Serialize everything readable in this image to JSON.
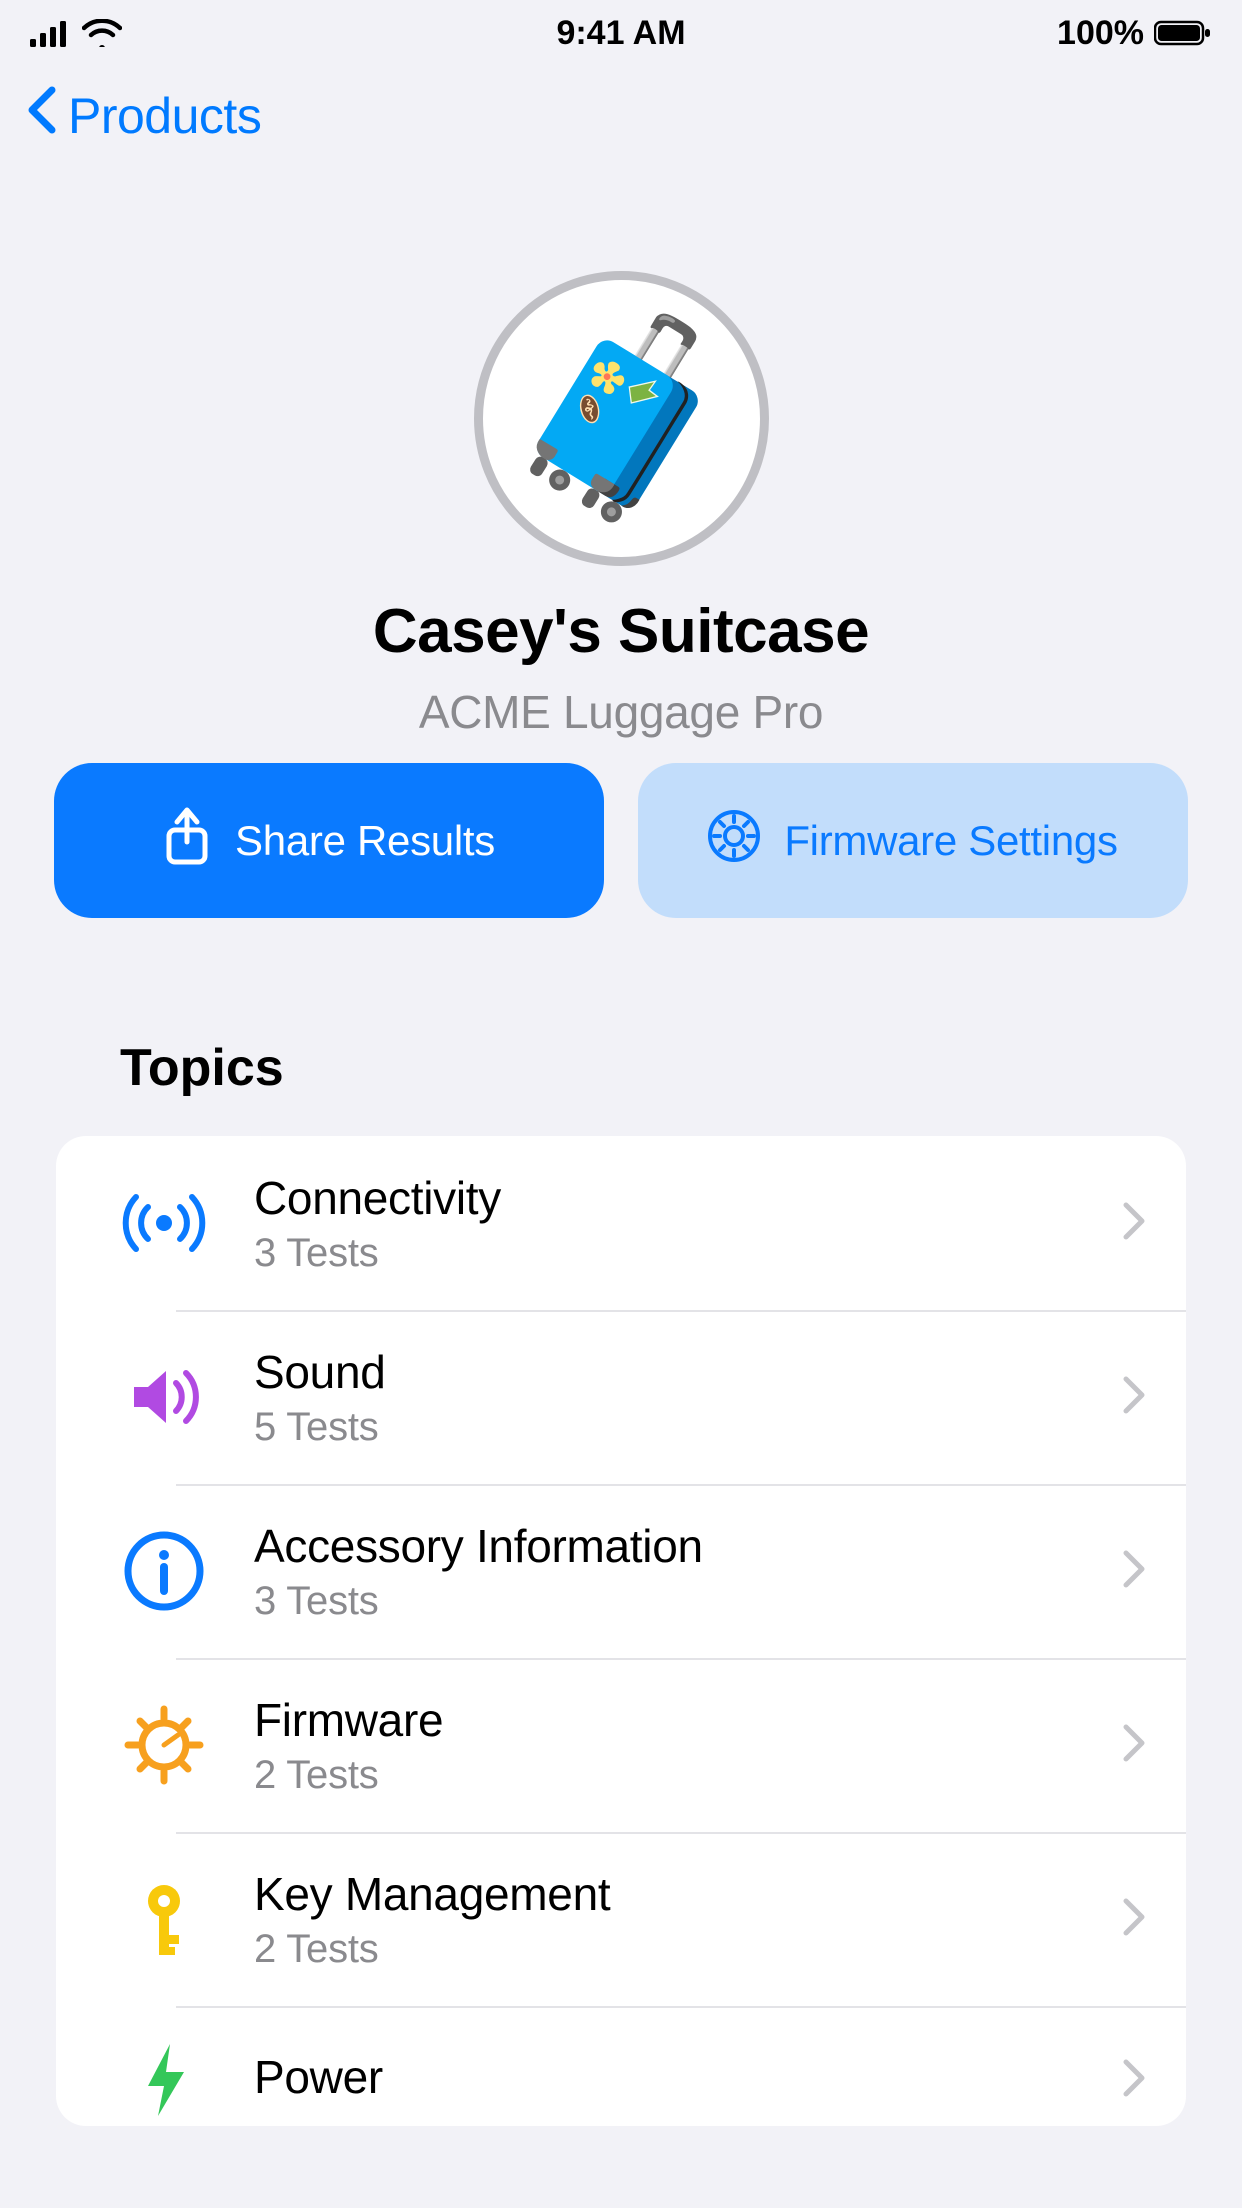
{
  "status": {
    "time": "9:41 AM",
    "battery_pct": "100%"
  },
  "nav": {
    "back_label": "Products"
  },
  "device": {
    "emoji": "🧳",
    "title": "Casey's Suitcase",
    "subtitle": "ACME Luggage Pro"
  },
  "actions": {
    "share_label": "Share Results",
    "firmware_label": "Firmware Settings"
  },
  "topics_header": "Topics",
  "topics": [
    {
      "title": "Connectivity",
      "sub": "3 Tests",
      "icon": "radio-icon",
      "color": "c-blue"
    },
    {
      "title": "Sound",
      "sub": "5 Tests",
      "icon": "speaker-icon",
      "color": "c-purple"
    },
    {
      "title": "Accessory Information",
      "sub": "3 Tests",
      "icon": "info-icon",
      "color": "c-blue"
    },
    {
      "title": "Firmware",
      "sub": "2 Tests",
      "icon": "gear-icon",
      "color": "c-orange"
    },
    {
      "title": "Key Management",
      "sub": "2 Tests",
      "icon": "key-icon",
      "color": "c-yellow"
    },
    {
      "title": "Power",
      "sub": "",
      "icon": "bolt-icon",
      "color": "c-green"
    }
  ]
}
